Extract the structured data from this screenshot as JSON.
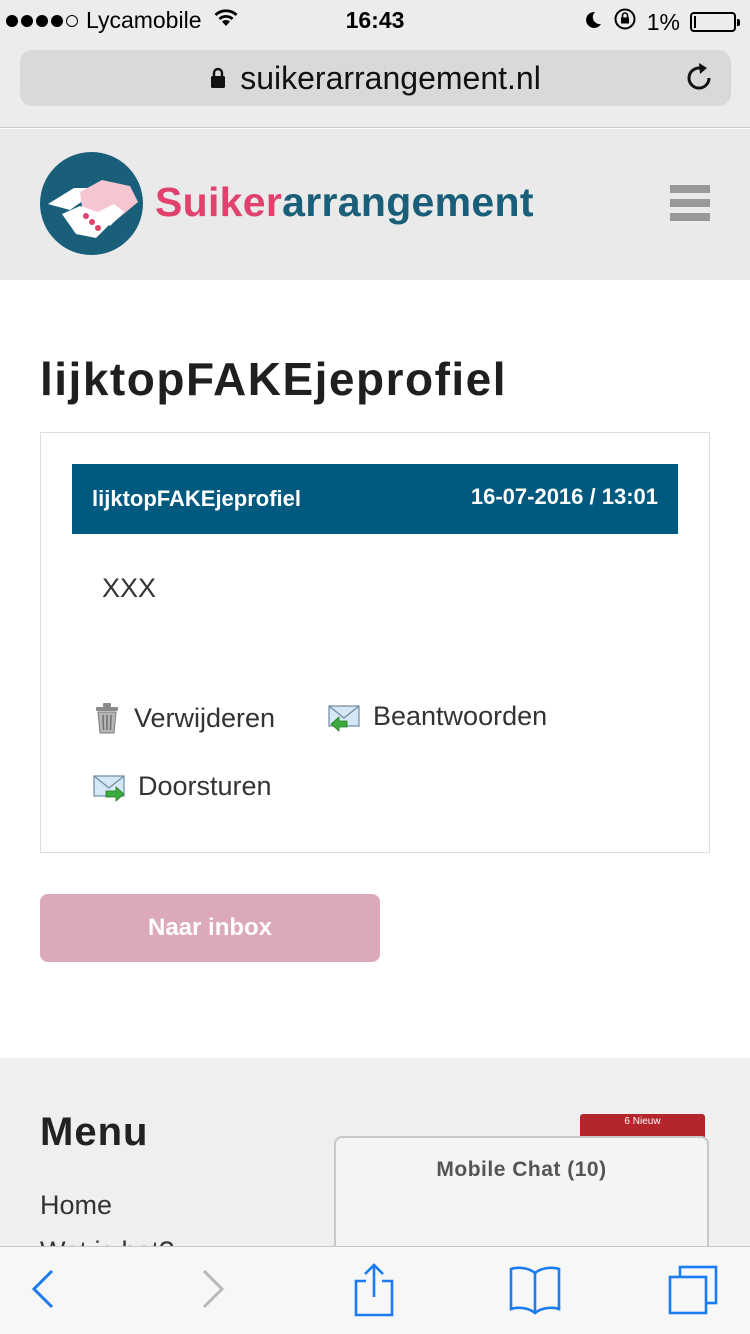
{
  "status_bar": {
    "carrier": "Lycamobile",
    "time": "16:43",
    "battery": "1%"
  },
  "browser": {
    "url": "suikerarrangement.nl"
  },
  "site": {
    "brand_part1": "Suiker",
    "brand_part2": "arrangement",
    "colors": {
      "pink": "#e0416d",
      "teal": "#1a5f7a",
      "header_bar": "#005a7f"
    }
  },
  "page": {
    "title": "lijktopFAKEjeprofiel"
  },
  "message": {
    "sender": "lijktopFAKEjeprofiel",
    "datetime": "16-07-2016 / 13:01",
    "body": "XXX",
    "actions": {
      "delete": "Verwijderen",
      "reply": "Beantwoorden",
      "forward": "Doorsturen"
    }
  },
  "inbox_button": "Naar inbox",
  "footer": {
    "title": "Menu",
    "links": [
      "Home",
      "Wat is het?"
    ]
  },
  "chat": {
    "badge": "6 Nieuw",
    "title": "Mobile Chat (10)"
  },
  "icons": {
    "status": [
      "signal-icon",
      "wifi-icon",
      "moon-icon",
      "rotation-lock-icon",
      "battery-icon"
    ],
    "toolbar": [
      "back-icon",
      "forward-icon",
      "share-icon",
      "bookmarks-icon",
      "tabs-icon"
    ]
  }
}
